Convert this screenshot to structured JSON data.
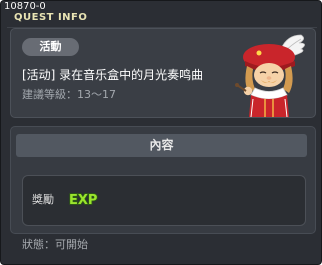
{
  "window": {
    "quest_id": "10870-0",
    "title": "QUEST INFO"
  },
  "quest": {
    "tag": "活動",
    "name": "[活动] 录在音乐盒中的月光奏鸣曲",
    "recommended_level": "建議等級：13〜17",
    "npc_icon": "red-hat-bard-npc-icon"
  },
  "content": {
    "header": "內容",
    "reward_label": "獎勵",
    "reward_icon": "exp-icon",
    "reward_icon_text": "EXP"
  },
  "status": {
    "text": "狀態：可開始"
  },
  "colors": {
    "window_bg": "#2b2e34",
    "title": "#e9e4b4",
    "exp_green": "#9be52d"
  }
}
